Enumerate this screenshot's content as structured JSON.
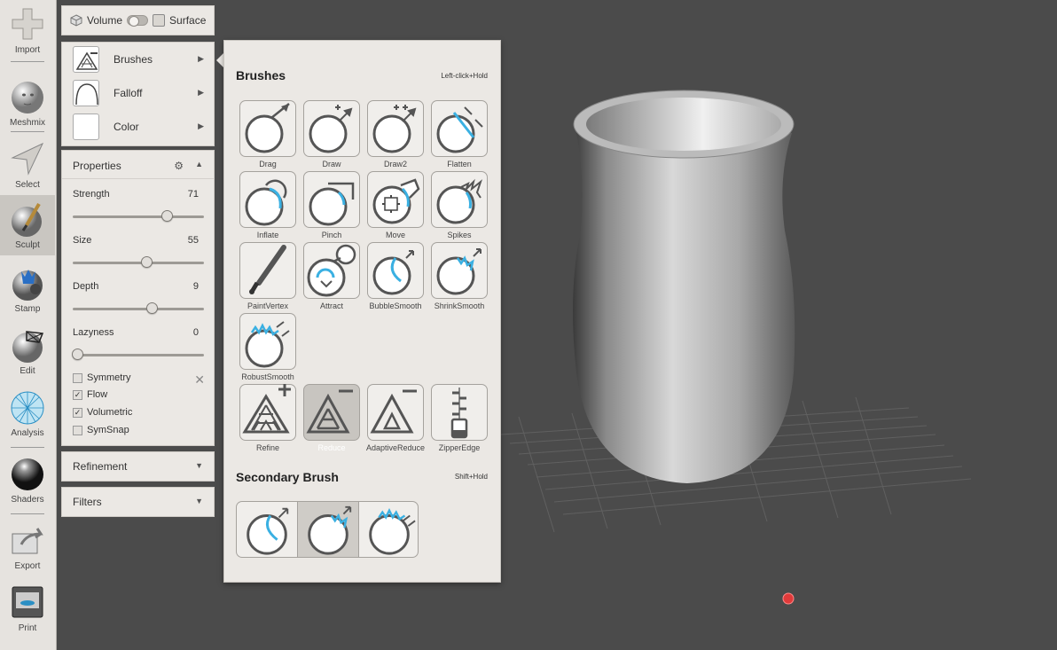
{
  "toolbar": {
    "items": [
      {
        "label": "Import",
        "icon": "plus-icon"
      },
      {
        "label": "Meshmix",
        "icon": "meshmix-head-icon"
      },
      {
        "label": "Select",
        "icon": "select-arrow-icon"
      },
      {
        "label": "Sculpt",
        "icon": "sculpt-brush-icon",
        "active": true
      },
      {
        "label": "Stamp",
        "icon": "stamp-icon"
      },
      {
        "label": "Edit",
        "icon": "edit-sphere-icon"
      },
      {
        "label": "Analysis",
        "icon": "analysis-mesh-icon"
      },
      {
        "label": "Shaders",
        "icon": "shader-sphere-icon"
      },
      {
        "label": "Export",
        "icon": "export-icon"
      },
      {
        "label": "Print",
        "icon": "printer-icon"
      }
    ]
  },
  "mode_toggle": {
    "volume_label": "Volume",
    "surface_label": "Surface"
  },
  "brush_selector": {
    "brushes_label": "Brushes",
    "falloff_label": "Falloff",
    "color_label": "Color"
  },
  "properties": {
    "title": "Properties",
    "sliders": [
      {
        "label": "Strength",
        "value": 71,
        "fraction": 0.71
      },
      {
        "label": "Size",
        "value": 55,
        "fraction": 0.55
      },
      {
        "label": "Depth",
        "value": 9,
        "fraction": 0.59
      },
      {
        "label": "Lazyness",
        "value": 0,
        "fraction": 0.0
      }
    ],
    "checkboxes": [
      {
        "label": "Symmetry",
        "checked": false
      },
      {
        "label": "Flow",
        "checked": true
      },
      {
        "label": "Volumetric",
        "checked": true
      },
      {
        "label": "SymSnap",
        "checked": false
      }
    ]
  },
  "refinement": {
    "title": "Refinement"
  },
  "filters": {
    "title": "Filters"
  },
  "brushes_popup": {
    "title": "Brushes",
    "hint": "Left-click+Hold",
    "brushes": [
      {
        "label": "Drag"
      },
      {
        "label": "Draw"
      },
      {
        "label": "Draw2"
      },
      {
        "label": "Flatten"
      },
      {
        "label": "Inflate"
      },
      {
        "label": "Pinch"
      },
      {
        "label": "Move"
      },
      {
        "label": "Spikes"
      },
      {
        "label": "PaintVertex"
      },
      {
        "label": "Attract"
      },
      {
        "label": "BubbleSmooth"
      },
      {
        "label": "ShrinkSmooth"
      },
      {
        "label": "RobustSmooth"
      },
      {
        "label": "Refine"
      },
      {
        "label": "Reduce",
        "selected": true
      },
      {
        "label": "AdaptiveReduce"
      },
      {
        "label": "ZipperEdge"
      }
    ],
    "secondary_title": "Secondary Brush",
    "secondary_hint": "Shift+Hold"
  },
  "colors": {
    "accent": "#3ab0e2",
    "panel": "#ebe8e4",
    "viewport": "#4b4b4b"
  }
}
